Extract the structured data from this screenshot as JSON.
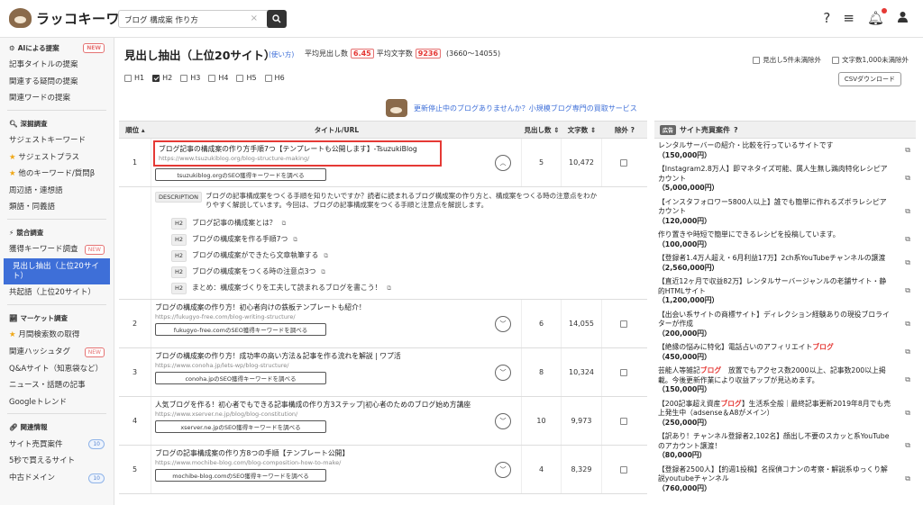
{
  "header": {
    "logo_text": "ラッコキーワード",
    "search_value": "ブログ 構成案 作り方",
    "clear": "×"
  },
  "sidebar": {
    "s1": "AIによる提案",
    "s1_badge": "NEW",
    "s1_items": [
      "記事タイトルの提案",
      "関連する疑問の提案",
      "関連ワードの提案"
    ],
    "s2": "深掘調査",
    "s2_items": [
      "サジェストキーワード",
      "サジェストプラス",
      "他のキーワード/質問β",
      "周辺語・連想語",
      "類語・同義語"
    ],
    "s3": "競合調査",
    "s3_items": [
      "獲得キーワード調査",
      "見出し抽出（上位20サイト）",
      "共起語（上位20サイト）"
    ],
    "s3_badge": "NEW",
    "s4": "マーケット調査",
    "s4_items": [
      "月間検索数の取得",
      "関連ハッシュタグ",
      "Q&Aサイト（知恵袋など）",
      "ニュース・話題の記事",
      "Googleトレンド"
    ],
    "s4_badge": "NEW",
    "s5": "関連情報",
    "s5_items": [
      "サイト売買案件",
      "5秒で買えるサイト",
      "中古ドメイン"
    ],
    "s5_badge": "10"
  },
  "main": {
    "title": "見出し抽出（上位20サイト）",
    "howto": "(使い方)",
    "avg_h_label": "平均見出し数",
    "avg_h": "6.45",
    "avg_w_label": "平均文字数",
    "avg_w": "9236",
    "range": "(3660〜14055)",
    "h_filters": [
      "H1",
      "H2",
      "H3",
      "H4",
      "H5",
      "H6"
    ],
    "opt1": "見出し5件未満除外",
    "opt2": "文字数1,000未満除外",
    "csv": "CSVダウンロード",
    "banner": "更新停止中のブログありませんか？小規模ブログ専門の買取サービス",
    "cols": {
      "rank": "順位",
      "title": "タイトル/URL",
      "heads": "見出し数",
      "chars": "文字数",
      "excl": "除外"
    }
  },
  "rows": [
    {
      "rank": "1",
      "title": "ブログ記事の構成案の作り方手順7つ【テンプレートも公開します】-TsuzukiBlog",
      "url": "https://www.tsuzukiblog.org/blog-structure-making/",
      "kw": "tsuzukiblog.orgのSEO獲得キーワードを調べる",
      "heads": "5",
      "chars": "10,472"
    },
    {
      "rank": "2",
      "title": "ブログの構成案の作り方！初心者向けの鉄板テンプレートも紹介！",
      "url": "https://fukugyo-free.com/blog-writing-structure/",
      "kw": "fukugyo-free.comのSEO獲得キーワードを調べる",
      "heads": "6",
      "chars": "14,055"
    },
    {
      "rank": "3",
      "title": "ブログの構成案の作り方！成功率の高い方法＆記事を作る流れを解説 | ワプ活",
      "url": "https://www.conoha.jp/lets-wp/blog-structure/",
      "kw": "conoha.jpのSEO獲得キーワードを調べる",
      "heads": "8",
      "chars": "10,324"
    },
    {
      "rank": "4",
      "title": "人気ブログを作る！初心者でもできる記事構成の作り方3ステップ|初心者のためのブログ始め方講座",
      "url": "https://www.xserver.ne.jp/blog/blog-constitution/",
      "kw": "xserver.ne.jpのSEO獲得キーワードを調べる",
      "heads": "10",
      "chars": "9,973"
    },
    {
      "rank": "5",
      "title": "ブログの記事構成案の作り方8つの手順【テンプレート公開】",
      "url": "https://www.mochibe-blog.com/blog-composition-how-to-make/",
      "kw": "mochibe-blog.comのSEO獲得キーワードを調べる",
      "heads": "4",
      "chars": "8,329"
    }
  ],
  "detail": {
    "tag": "DESCRIPTION",
    "text": "ブログの記事構成案をつくる手順を知りたいですか？読者に読まれるブログ構成案の作り方と、構成案をつくる時の注意点をわかりやすく解説しています。今回は、ブログの記事構成案をつくる手順と注意点を解説します。",
    "h2": [
      "ブログ記事の構成案とは？",
      "ブログの構成案を作る手順7つ",
      "ブログの構成案ができたら文章執筆する",
      "ブログの構成案をつくる時の注意点3つ",
      "まとめ：構成案づくりを工夫して読まれるブログを書こう！"
    ],
    "h2_tag": "H2"
  },
  "ads": {
    "tag": "広告",
    "title": "サイト売買案件",
    "items": [
      {
        "t": "レンタルサーバーの紹介・比較を行っているサイトです",
        "p": "（150,000円）"
      },
      {
        "t": "【Instagram2.8万人】即マネタイズ可能、属人生無し鶏肉特化レシピアカウント",
        "p": "（5,000,000円）"
      },
      {
        "t": "【インスタフォロワー5800人以上】誰でも簡単に作れるズボラレシピアカウント",
        "p": "（120,000円）"
      },
      {
        "t": "作り置きや時短で簡単にできるレシピを投稿しています。",
        "p": "（100,000円）"
      },
      {
        "t": "【登録者1.4万人超え・6月利益17万】2ch系YouTubeチャンネルの譲渡",
        "p": "（2,560,000円）"
      },
      {
        "t": "【直近12ヶ月で収益82万】レンタルサーバージャンルの老舗サイト・静的HTMLサイト",
        "p": "（1,200,000円）"
      },
      {
        "t": "【出会い系サイトの商標サイト】ディレクション経験ありの現役ブロライターが作成",
        "p": "（200,000円）"
      },
      {
        "t": "【絶縁の悩みに特化】電話占いのアフィリエイトブログ",
        "p": "（450,000円）"
      },
      {
        "t": "芸能人等雑記ブログ　放置でもアクセス数2000以上、記事数200以上掲載。今後更新作業により収益アップが見込めます。",
        "p": "（150,000円）"
      },
      {
        "t": "【200記事超え資産ブログ】生活系全般｜最終記事更新2019年8月でも売上発生中（adsense＆A8がメイン）",
        "p": "（250,000円）"
      },
      {
        "t": "【訳あり！チャンネル登録者2,102名】顔出し不要のスカッと系YouTubeのアカウント譲渡！",
        "p": "（80,000円）"
      },
      {
        "t": "【登録者2500人】【約週1投稿】名探偵コナンの考察・解説系ゆっくり解説youtubeチャンネル",
        "p": "（760,000円）"
      }
    ]
  }
}
